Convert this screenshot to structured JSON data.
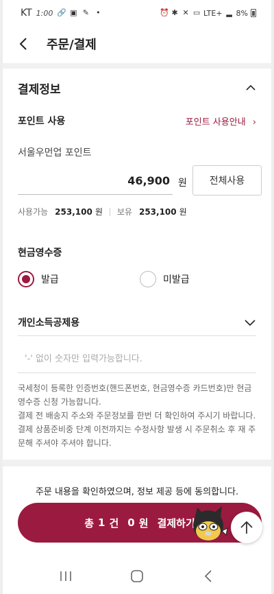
{
  "status_bar": {
    "carrier": "KT",
    "time": "1:00",
    "network": "LTE+",
    "battery": "8%"
  },
  "header": {
    "title": "주문/결제"
  },
  "payment_section": {
    "title": "결제정보"
  },
  "points": {
    "title": "포인트 사용",
    "guide_link": "포인트 사용안내",
    "guide_chevron": "›",
    "label": "서울우먼업 포인트",
    "amount": "46,900",
    "unit": "원",
    "use_all_button": "전체사용",
    "available_label": "사용가능",
    "available_value": "253,100",
    "available_unit": "원",
    "held_label": "보유",
    "held_value": "253,100",
    "held_unit": "원"
  },
  "receipt": {
    "title": "현금영수증",
    "options": [
      {
        "label": "발급",
        "selected": true
      },
      {
        "label": "미발급",
        "selected": false
      }
    ],
    "purpose": "개인소득공제용",
    "input_placeholder": "'-' 없이 숫자만 입력가능합니다.",
    "notice_lines": [
      "국세청이 등록한 인증번호(핸드폰번호, 현금영수증 카드번호)만 현금영수증 신청 가능합니다.",
      "결제 전 배송지 주소와 주문정보를 한번 더 확인하여 주시기 바랍니다.",
      "결제 상품준비중 단계 이전까지는 수정사항 발생 시 주문취소 후 재 주문해 주셔야 주셔야 합니다."
    ]
  },
  "footer": {
    "agreement": "주문 내용을 확인하였으며, 정보 제공 등에 동의합니다.",
    "pay_prefix": "총",
    "pay_count": "1",
    "pay_count_unit": "건",
    "pay_amount": "0",
    "pay_amount_unit": "원",
    "pay_action": "결제하기"
  },
  "colors": {
    "accent": "#9b1a3f",
    "divider": "#f1f1f1"
  },
  "icons": {
    "back": "back-arrow-icon",
    "collapse": "chevron-up-icon",
    "expand": "chevron-down-icon",
    "scroll_top": "arrow-up-icon"
  }
}
